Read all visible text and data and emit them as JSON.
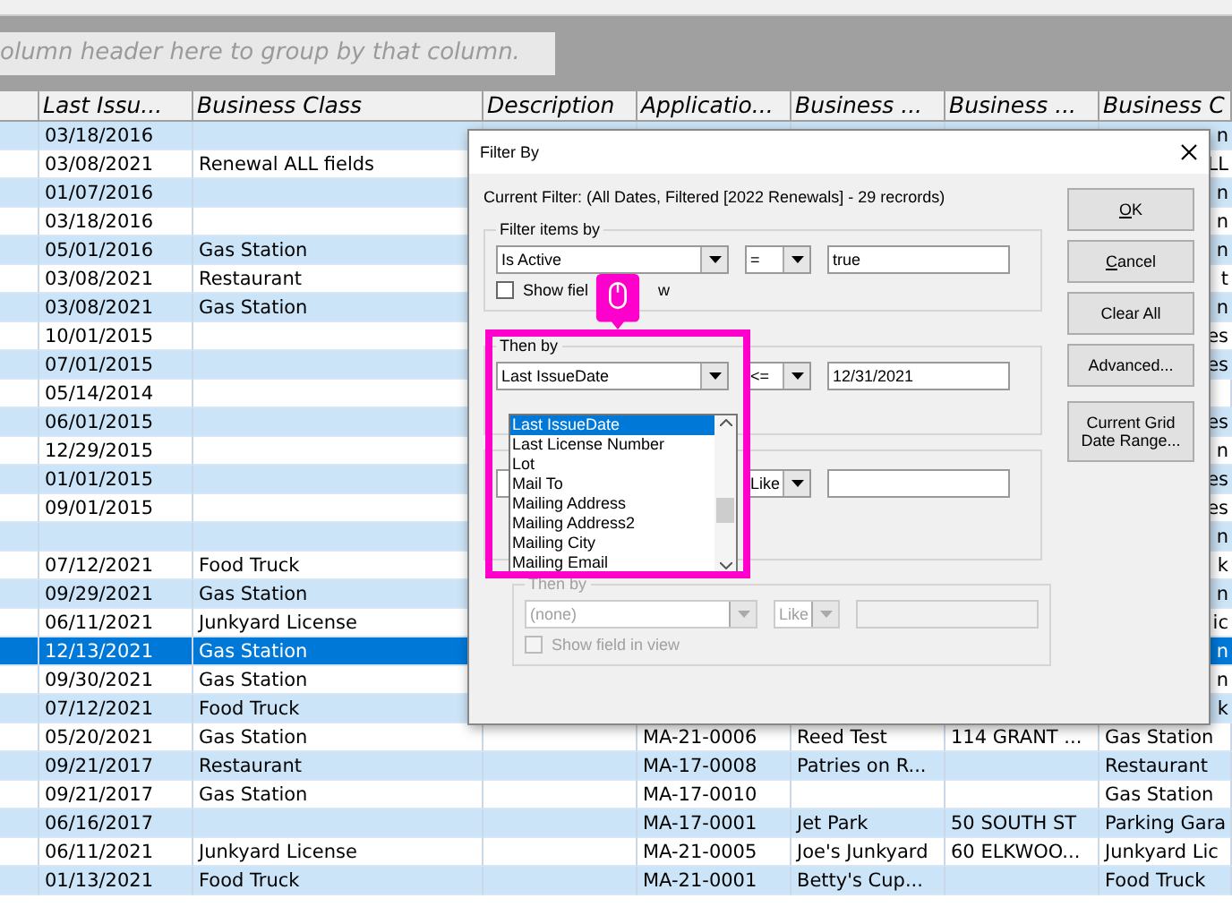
{
  "group_panel": {
    "hint": "olumn header here to group by that column."
  },
  "grid": {
    "columns": [
      "Last Issu...",
      "Business Class",
      "Description",
      "Applicatio...",
      "Business ...",
      "Business ...",
      "Business C"
    ],
    "rows": [
      {
        "cells": [
          "03/18/2016",
          null,
          null,
          null,
          null,
          null,
          "n"
        ],
        "covered": true,
        "selected": false
      },
      {
        "cells": [
          "03/08/2021",
          "Renewal ALL fields",
          null,
          null,
          null,
          null,
          "LL"
        ],
        "covered": true,
        "selected": false
      },
      {
        "cells": [
          "01/07/2016",
          null,
          null,
          null,
          null,
          null,
          "n"
        ],
        "covered": true,
        "selected": false
      },
      {
        "cells": [
          "03/18/2016",
          null,
          null,
          null,
          null,
          null,
          "n"
        ],
        "covered": true,
        "selected": false
      },
      {
        "cells": [
          "05/01/2016",
          "Gas Station",
          null,
          null,
          null,
          null,
          "n"
        ],
        "covered": true,
        "selected": false
      },
      {
        "cells": [
          "03/08/2021",
          "Restaurant",
          null,
          null,
          null,
          null,
          "t"
        ],
        "covered": true,
        "selected": false
      },
      {
        "cells": [
          "03/08/2021",
          "Gas Station",
          null,
          null,
          null,
          null,
          "n"
        ],
        "covered": true,
        "selected": false
      },
      {
        "cells": [
          "10/01/2015",
          null,
          null,
          null,
          null,
          null,
          "es"
        ],
        "covered": true,
        "selected": false
      },
      {
        "cells": [
          "07/01/2015",
          null,
          null,
          null,
          null,
          null,
          "es"
        ],
        "covered": true,
        "selected": false
      },
      {
        "cells": [
          "05/14/2014",
          null,
          null,
          null,
          null,
          null,
          null
        ],
        "selected": false
      },
      {
        "cells": [
          "06/01/2015",
          null,
          null,
          null,
          null,
          null,
          "es"
        ],
        "covered": true,
        "selected": false
      },
      {
        "cells": [
          "12/29/2015",
          null,
          null,
          null,
          null,
          null,
          "n"
        ],
        "covered": true,
        "selected": false
      },
      {
        "cells": [
          "01/01/2015",
          null,
          null,
          null,
          null,
          null,
          "es"
        ],
        "covered": true,
        "selected": false
      },
      {
        "cells": [
          "09/01/2015",
          null,
          null,
          null,
          null,
          null,
          "es"
        ],
        "covered": true,
        "selected": false
      },
      {
        "cells": [
          null,
          null,
          null,
          null,
          null,
          null,
          "n"
        ],
        "covered": true,
        "selected": false
      },
      {
        "cells": [
          "07/12/2021",
          "Food Truck",
          null,
          null,
          null,
          null,
          "k"
        ],
        "covered": true,
        "selected": false
      },
      {
        "cells": [
          "09/29/2021",
          "Gas Station",
          null,
          null,
          null,
          null,
          "n"
        ],
        "covered": true,
        "selected": false
      },
      {
        "cells": [
          "06/11/2021",
          "Junkyard License",
          null,
          null,
          null,
          null,
          "ic"
        ],
        "covered": true,
        "selected": false
      },
      {
        "cells": [
          "12/13/2021",
          "Gas Station",
          null,
          null,
          null,
          null,
          "n"
        ],
        "covered": true,
        "selected": true
      },
      {
        "cells": [
          "09/30/2021",
          "Gas Station",
          null,
          null,
          null,
          null,
          "n"
        ],
        "covered": true,
        "selected": false
      },
      {
        "cells": [
          "07/12/2021",
          "Food Truck",
          null,
          null,
          null,
          null,
          "k"
        ],
        "covered": true,
        "selected": false
      },
      {
        "cells": [
          "05/20/2021",
          "Gas Station",
          null,
          "MA-21-0006",
          "Reed Test",
          "114 GRANT ...",
          "Gas Station"
        ],
        "covered": false,
        "selected": false
      },
      {
        "cells": [
          "09/21/2017",
          "Restaurant",
          null,
          "MA-17-0008",
          "Patries on R...",
          null,
          "Restaurant"
        ],
        "covered": false,
        "selected": false
      },
      {
        "cells": [
          "09/21/2017",
          "Gas Station",
          null,
          "MA-17-0010",
          null,
          null,
          "Gas Station"
        ],
        "covered": false,
        "selected": false
      },
      {
        "cells": [
          "06/16/2017",
          null,
          null,
          "MA-17-0001",
          "Jet Park",
          "50 SOUTH ST",
          "Parking Gara"
        ],
        "covered": false,
        "selected": false
      },
      {
        "cells": [
          "06/11/2021",
          "Junkyard License",
          null,
          "MA-21-0005",
          "Joe's Junkyard",
          "60 ELKWOO...",
          "Junkyard Lic"
        ],
        "covered": false,
        "selected": false
      },
      {
        "cells": [
          "01/13/2021",
          "Food Truck",
          null,
          "MA-21-0001",
          "Betty's Cup...",
          null,
          "Food Truck"
        ],
        "covered": false,
        "selected": false
      }
    ]
  },
  "dialog": {
    "title": "Filter By",
    "current_filter": "Current Filter: (All Dates, Filtered [2022 Renewals] - 29 recrords)",
    "filters": [
      {
        "kind": "active",
        "title": "Filter items by",
        "field": "Is Active",
        "operator": "=",
        "value": "true",
        "disabled": false,
        "show_field": {
          "label_parts": [
            "Show fiel",
            "w"
          ],
          "checked": false
        }
      },
      {
        "kind": "active",
        "title": "Then by",
        "field": "Last IssueDate",
        "operator": "<=",
        "value": "12/31/2021",
        "disabled": false,
        "dropdown": {
          "items": [
            {
              "label": "Last IssueDate",
              "selected": true
            },
            {
              "label": "Last License Number",
              "selected": false
            },
            {
              "label": "Lot",
              "selected": false
            },
            {
              "label": "Mail To",
              "selected": false
            },
            {
              "label": "Mailing Address",
              "selected": false
            },
            {
              "label": "Mailing Address2",
              "selected": false
            },
            {
              "label": "Mailing City",
              "selected": false
            },
            {
              "label": "Mailing Email",
              "selected": false
            }
          ]
        }
      },
      {
        "kind": "covered",
        "operator": "Like",
        "disabled": false
      },
      {
        "kind": "active",
        "title": "Then by",
        "field": "(none)",
        "operator": "Like",
        "disabled": true,
        "show_field": {
          "label_parts": [
            "Show field in view"
          ],
          "checked": false
        }
      }
    ],
    "buttons": [
      {
        "access": "O",
        "rest": "K"
      },
      {
        "access": "C",
        "rest": "ancel"
      },
      {
        "rest": "Clear All"
      },
      {
        "rest": "Advanced..."
      },
      {
        "rest": "Current Grid Date Range..."
      }
    ]
  }
}
